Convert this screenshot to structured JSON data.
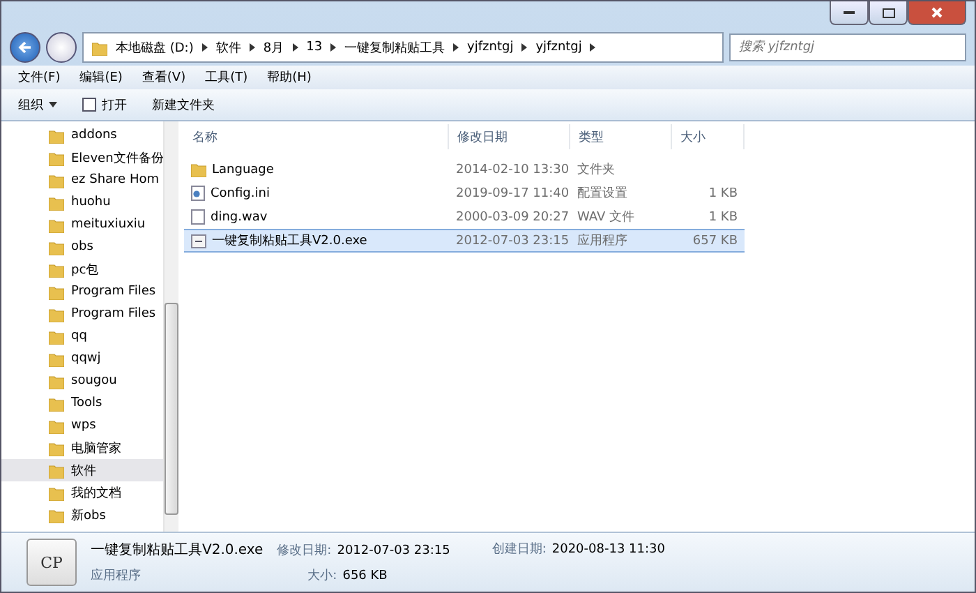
{
  "address": {
    "breadcrumbs": [
      "本地磁盘 (D:)",
      "软件",
      "8月",
      "13",
      "一键复制粘贴工具",
      "yjfzntgj",
      "yjfzntgj"
    ]
  },
  "search": {
    "placeholder": "搜索 yjfzntgj"
  },
  "menu": [
    "文件(F)",
    "编辑(E)",
    "查看(V)",
    "工具(T)",
    "帮助(H)"
  ],
  "toolbar": {
    "organize": "组织",
    "open": "打开",
    "new_folder": "新建文件夹"
  },
  "sidebar": {
    "items": [
      {
        "label": "addons",
        "selected": false
      },
      {
        "label": "Eleven文件备份",
        "selected": false
      },
      {
        "label": "ez Share Hom",
        "selected": false
      },
      {
        "label": "huohu",
        "selected": false
      },
      {
        "label": "meituxiuxiu",
        "selected": false
      },
      {
        "label": "obs",
        "selected": false
      },
      {
        "label": "pc包",
        "selected": false
      },
      {
        "label": "Program Files",
        "selected": false
      },
      {
        "label": "Program Files",
        "selected": false
      },
      {
        "label": "qq",
        "selected": false
      },
      {
        "label": "qqwj",
        "selected": false
      },
      {
        "label": "sougou",
        "selected": false
      },
      {
        "label": "Tools",
        "selected": false
      },
      {
        "label": "wps",
        "selected": false
      },
      {
        "label": "电脑管家",
        "selected": false
      },
      {
        "label": "软件",
        "selected": true
      },
      {
        "label": "我的文档",
        "selected": false
      },
      {
        "label": "新obs",
        "selected": false
      }
    ]
  },
  "table": {
    "columns": [
      "名称",
      "修改日期",
      "类型",
      "大小"
    ],
    "rows": [
      {
        "kind": "folder",
        "name": "Language",
        "date": "2014-02-10 13:30",
        "type": "文件夹",
        "size": "",
        "selected": false
      },
      {
        "kind": "settings",
        "name": "Config.ini",
        "date": "2019-09-17 11:40",
        "type": "配置设置",
        "size": "1 KB",
        "selected": false
      },
      {
        "kind": "file",
        "name": "ding.wav",
        "date": "2000-03-09 20:27",
        "type": "WAV 文件",
        "size": "1 KB",
        "selected": false
      },
      {
        "kind": "app",
        "name": "一键复制粘贴工具V2.0.exe",
        "date": "2012-07-03 23:15",
        "type": "应用程序",
        "size": "657 KB",
        "selected": true
      }
    ]
  },
  "details": {
    "icon_text": "CP",
    "name": "一键复制粘贴工具V2.0.exe",
    "type": "应用程序",
    "modified_label": "修改日期:",
    "modified": "2012-07-03 23:15",
    "size_label": "大小:",
    "size": "656 KB",
    "created_label": "创建日期:",
    "created": "2020-08-13 11:30"
  }
}
